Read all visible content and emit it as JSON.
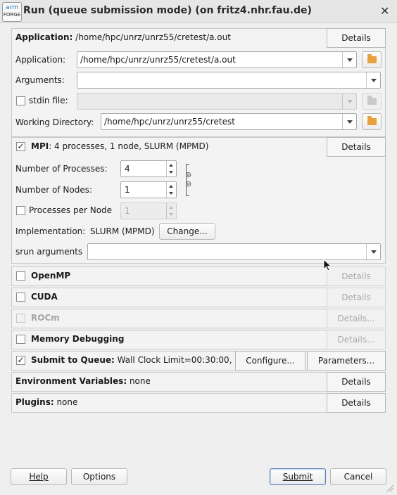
{
  "window": {
    "title": "Run (queue submission mode) (on fritz4.nhr.fau.de)",
    "logo_top": "arm",
    "logo_bottom": "FORGE",
    "close_glyph": "✕"
  },
  "application": {
    "header_bold": "Application:",
    "header_value": " /home/hpc/unrz/unrz55/cretest/a.out",
    "details_label": "Details",
    "application_label": "Application:",
    "application_value": "/home/hpc/unrz/unrz55/cretest/a.out",
    "arguments_label": "Arguments:",
    "arguments_value": "",
    "stdin_label": "stdin file:",
    "stdin_value": "",
    "workdir_label": "Working Directory:",
    "workdir_value": "/home/hpc/unrz/unrz55/cretest"
  },
  "mpi": {
    "checked": "✓",
    "header_bold": "MPI",
    "header_value": ": 4 processes, 1 node, SLURM (MPMD)",
    "details_label": "Details",
    "num_processes_label": "Number of Processes:",
    "num_processes_value": "4",
    "num_nodes_label": "Number of Nodes:",
    "num_nodes_value": "1",
    "ppn_label": "Processes per Node",
    "ppn_value": "1",
    "implementation_label": "Implementation:",
    "implementation_value": "SLURM (MPMD)",
    "change_label": "Change...",
    "srun_label": "srun arguments",
    "srun_value": ""
  },
  "openmp": {
    "label": "OpenMP",
    "details_label": "Details"
  },
  "cuda": {
    "label": "CUDA",
    "details_label": "Details"
  },
  "rocm": {
    "label": "ROCm",
    "details_label": "Details..."
  },
  "memdebug": {
    "label": "Memory Debugging",
    "details_label": "Details..."
  },
  "queue": {
    "checked": "✓",
    "label": "Submit to Queue:",
    "value": " Wall Clock Limit=00:30:00,",
    "configure_label": "Configure...",
    "parameters_label": "Parameters..."
  },
  "env": {
    "label": "Environment Variables:",
    "value": " none",
    "details_label": "Details"
  },
  "plugins": {
    "label": "Plugins:",
    "value": " none",
    "details_label": "Details"
  },
  "footer": {
    "help_label": "Help",
    "options_label": "Options",
    "submit_label": "Submit",
    "cancel_label": "Cancel"
  },
  "icons": {
    "folder": "folder-icon",
    "link": "link-icon",
    "dropdown": "chevron-down-icon"
  }
}
